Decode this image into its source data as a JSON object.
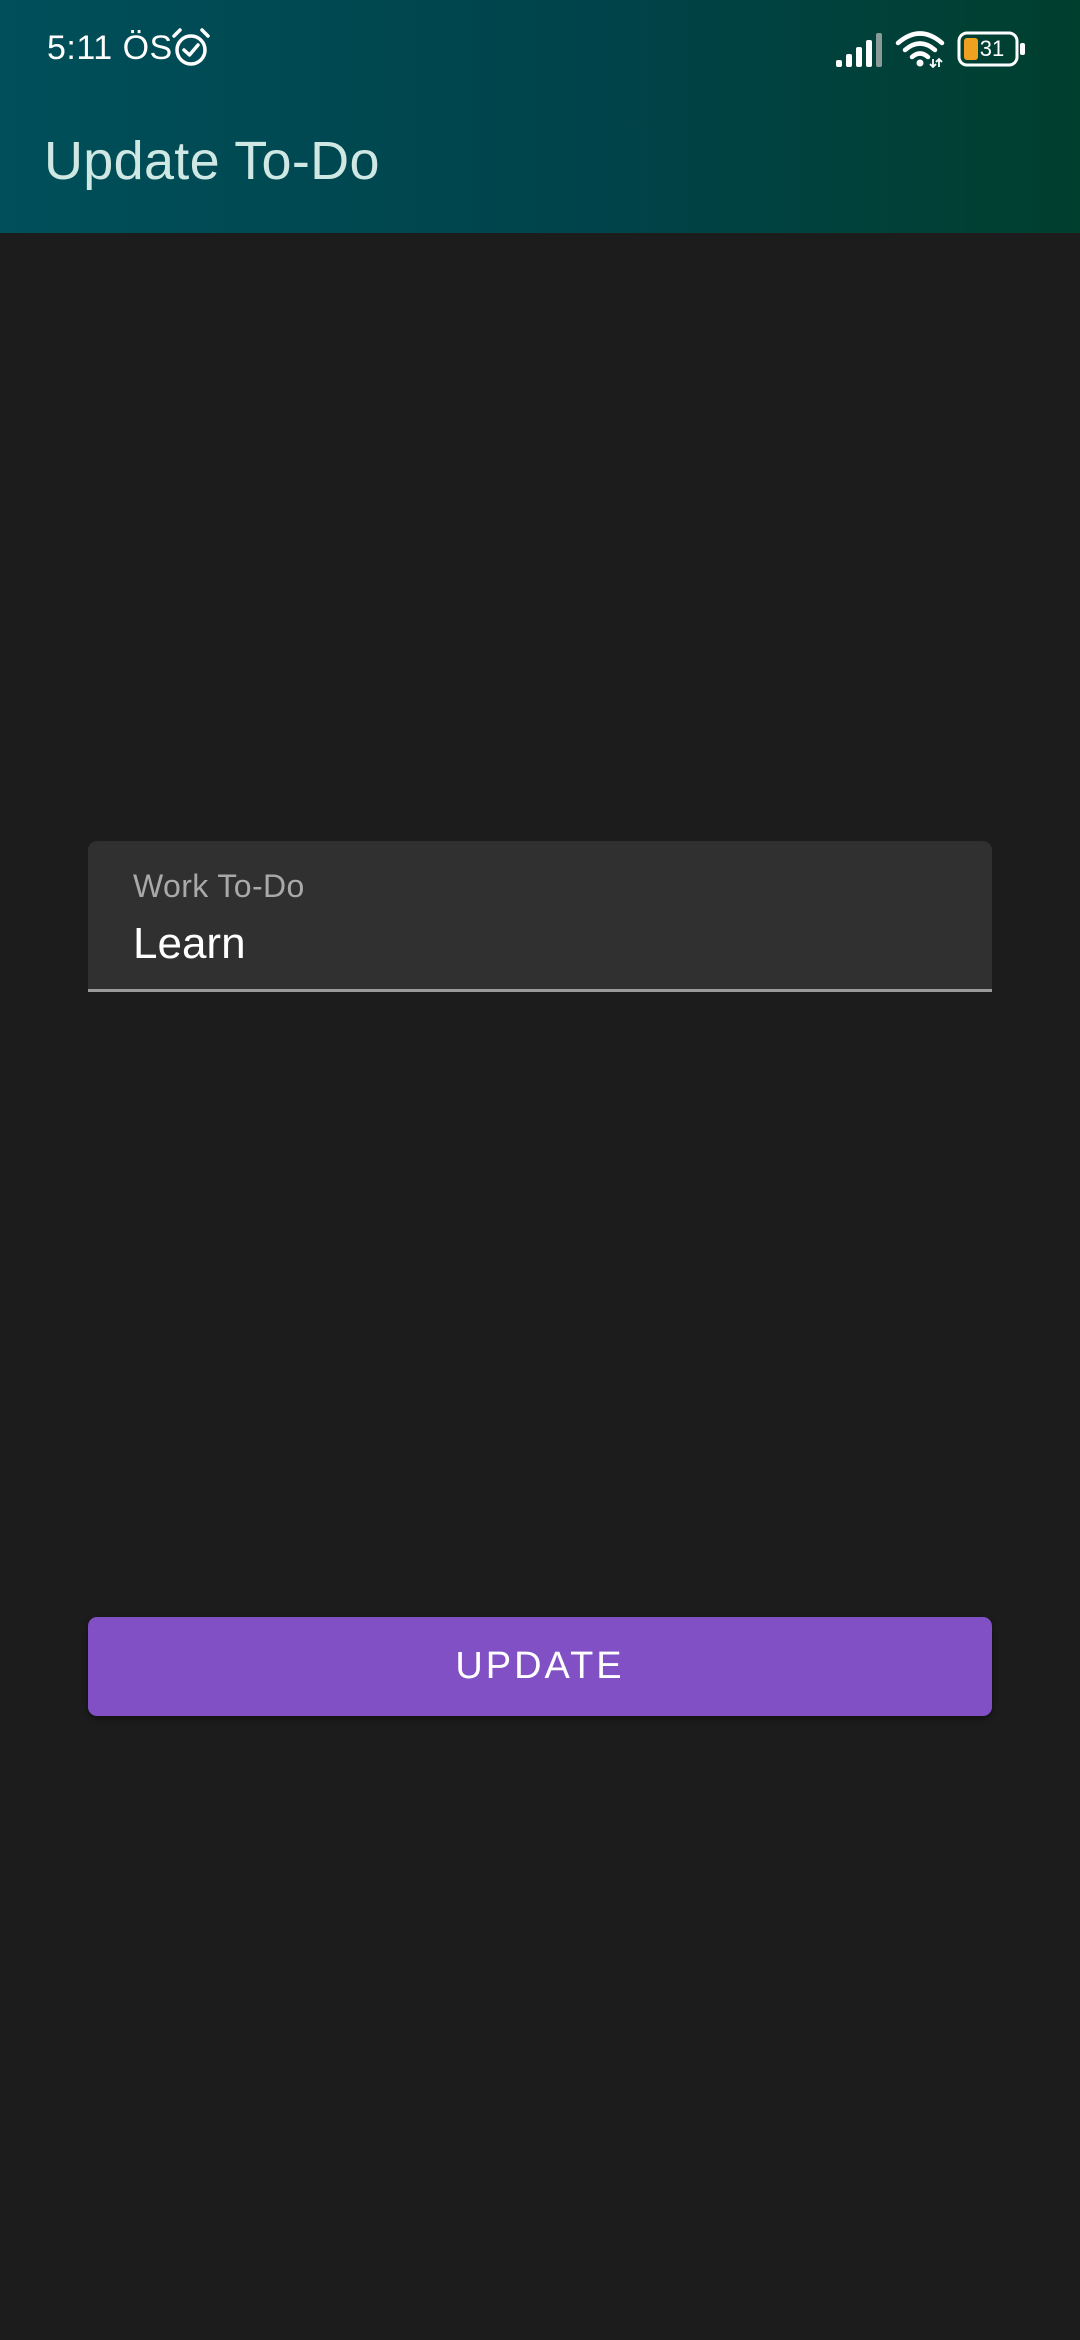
{
  "status_bar": {
    "time": "5:11 ÖS",
    "alarm_icon": "alarm-clock-icon",
    "signal_icon": "cellular-signal-icon",
    "wifi_icon": "wifi-icon",
    "battery_icon": "battery-icon",
    "battery_level": "31"
  },
  "app_bar": {
    "title": "Update To-Do",
    "gradient_start": "#004f5a",
    "gradient_end": "#003f2e"
  },
  "form": {
    "field_label": "Work To-Do",
    "field_value": "Learn"
  },
  "actions": {
    "update_label": "UPDATE",
    "button_color": "#8150c4"
  },
  "theme": {
    "background": "#1c1c1c",
    "field_background": "#303030"
  }
}
